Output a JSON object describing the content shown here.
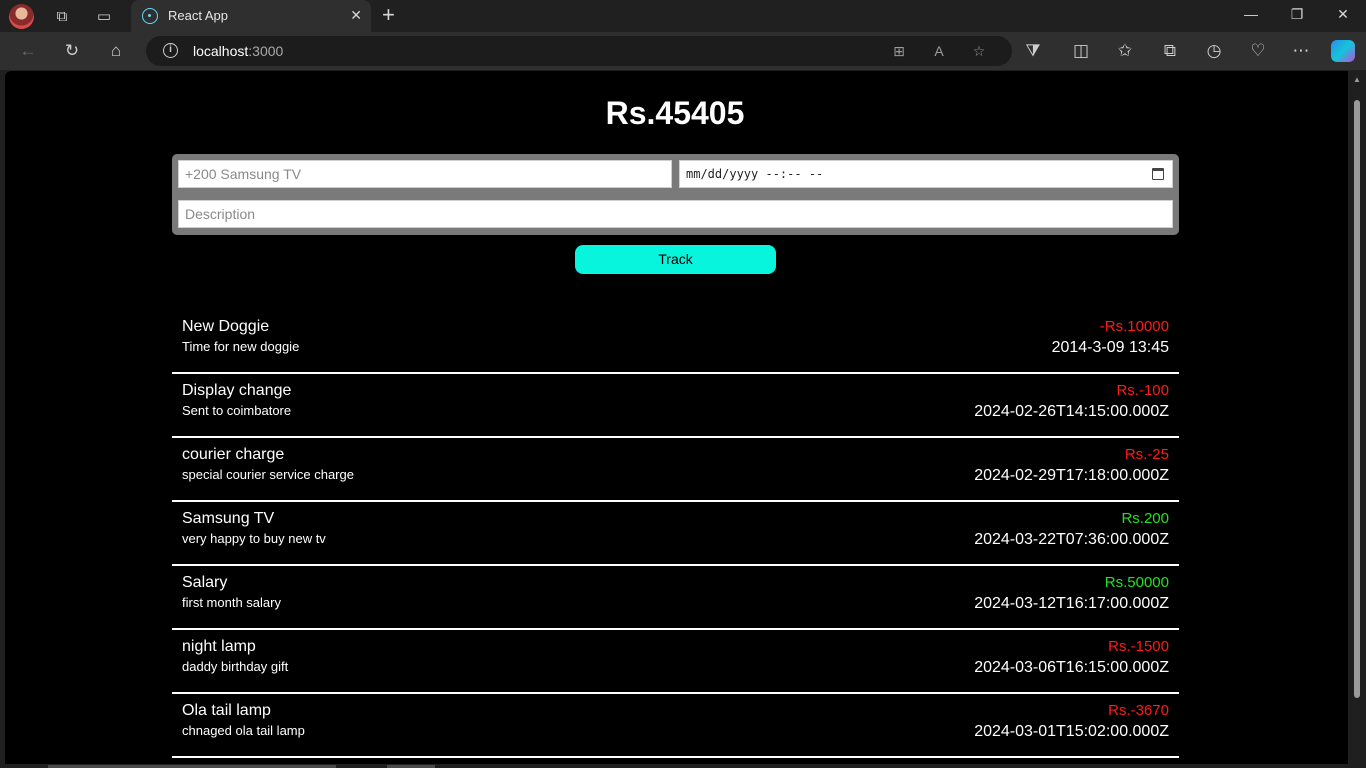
{
  "browser": {
    "tab_title": "React App",
    "url_host": "localhost",
    "url_port": ":3000"
  },
  "app": {
    "balance": "Rs.45405",
    "form": {
      "name_placeholder": "+200 Samsung TV",
      "datetime_placeholder": "mm/dd/yyyy --:-- --",
      "description_placeholder": "Description",
      "track_label": "Track"
    },
    "transactions": [
      {
        "name": "New Doggie",
        "description": "Time for new doggie",
        "price": "-Rs.10000",
        "date": "2014-3-09 13:45",
        "color": "#ff1a1a"
      },
      {
        "name": "Display change",
        "description": "Sent to coimbatore",
        "price": "Rs.-100",
        "date": "2024-02-26T14:15:00.000Z",
        "color": "#ff1a1a"
      },
      {
        "name": "courier charge",
        "description": "special courier service charge",
        "price": "Rs.-25",
        "date": "2024-02-29T17:18:00.000Z",
        "color": "#ff1a1a"
      },
      {
        "name": "Samsung TV",
        "description": "very happy to buy new tv",
        "price": "Rs.200",
        "date": "2024-03-22T07:36:00.000Z",
        "color": "#22e022"
      },
      {
        "name": "Salary",
        "description": "first month salary",
        "price": "Rs.50000",
        "date": "2024-03-12T16:17:00.000Z",
        "color": "#22e022"
      },
      {
        "name": "night lamp",
        "description": "daddy birthday gift",
        "price": "Rs.-1500",
        "date": "2024-03-06T16:15:00.000Z",
        "color": "#ff1a1a"
      },
      {
        "name": "Ola tail lamp",
        "description": "chnaged ola tail lamp",
        "price": "Rs.-3670",
        "date": "2024-03-01T15:02:00.000Z",
        "color": "#ff1a1a"
      }
    ]
  }
}
